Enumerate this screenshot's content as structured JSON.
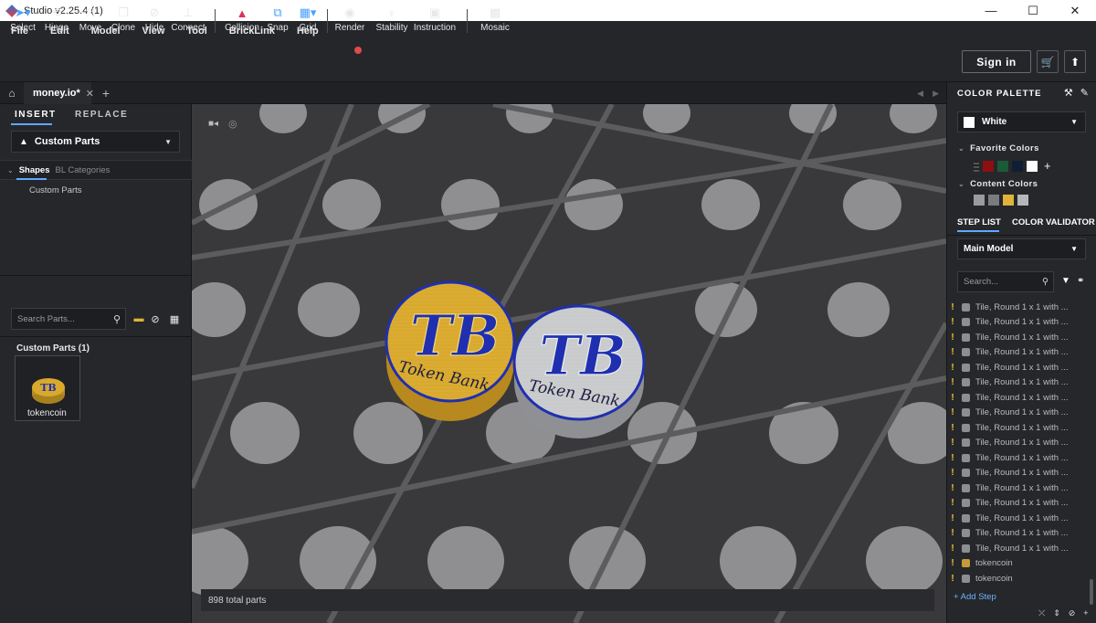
{
  "window": {
    "title": "Studio v2.25.4 (1)",
    "minimize": "—",
    "maximize": "☐",
    "close": "✕"
  },
  "menu": [
    "File",
    "Edit",
    "Model",
    "View",
    "Tool",
    "BrickLink",
    "Help"
  ],
  "toolbar": {
    "tools": [
      {
        "label": "Select",
        "icon": "select-arrow-icon",
        "glyph": "➤▾"
      },
      {
        "label": "Hinge",
        "icon": "hinge-icon",
        "glyph": "⟲"
      },
      {
        "label": "Move",
        "icon": "move-icon",
        "glyph": "⤧"
      },
      {
        "label": "Clone",
        "icon": "clone-icon",
        "glyph": "❐"
      },
      {
        "label": "Hide",
        "icon": "hide-icon",
        "glyph": "⊘"
      },
      {
        "label": "Connect",
        "icon": "connect-icon",
        "glyph": "⊥"
      },
      {
        "label": "Collision",
        "icon": "collision-icon",
        "glyph": "▲"
      },
      {
        "label": "Snap",
        "icon": "snap-icon",
        "glyph": "⧉"
      },
      {
        "label": "Grid",
        "icon": "grid-icon",
        "glyph": "▦▾"
      },
      {
        "label": "Render",
        "icon": "render-camera-icon",
        "glyph": "◉"
      },
      {
        "label": "Stability",
        "icon": "stability-icon",
        "glyph": "♆"
      },
      {
        "label": "Instruction",
        "icon": "instruction-icon",
        "glyph": "▣"
      },
      {
        "label": "Mosaic",
        "icon": "mosaic-icon",
        "glyph": "▩"
      }
    ],
    "sign_in": "Sign in",
    "cart_icon": "🛒",
    "upload_icon": "⬆",
    "collision_color": "#e0305a",
    "snap_color": "#4aa0ff",
    "render_badge_color": "#e04a4a"
  },
  "tabs": {
    "home": "⌂",
    "document": "money.io*",
    "close": "✕",
    "add": "+",
    "nav_prev": "◀",
    "nav_next": "▶"
  },
  "left_panel": {
    "tab_insert": "INSERT",
    "tab_replace": "REPLACE",
    "parts_dropdown": "Custom Parts",
    "shapes_tab": "Shapes",
    "bl_categories_tab": "BL Categories",
    "category_item": "Custom Parts",
    "search_placeholder": "Search Parts...",
    "custom_parts_count": "Custom Parts (1)",
    "part_name": "tokencoin"
  },
  "viewport": {
    "status": "898 total parts",
    "coin_text_top": "TB",
    "coin_text_bottom": "Token Bank",
    "coin_gold_color": "#d8a92c",
    "coin_silver_color": "#c9cacc",
    "coin_ink_color": "#1f2fb0"
  },
  "right_panel": {
    "color_palette_title": "COLOR PALETTE",
    "selected_color": "White",
    "favorite_colors_label": "Favorite Colors",
    "favorite_colors": [
      "#2a2a2a",
      "#8c1010",
      "#1b5a36",
      "#0f1f33",
      "#ffffff"
    ],
    "content_colors_label": "Content Colors",
    "content_colors": [
      "#9a9b9f",
      "#7a7b80",
      "#e0b43a",
      "#b6b7bb"
    ],
    "tab_step_list": "STEP LIST",
    "tab_color_validator": "COLOR VALIDATOR",
    "model_dropdown": "Main Model",
    "search_placeholder": "Search...",
    "steps": [
      {
        "label": "Tile, Round 1 x 1 with ...",
        "warn": true,
        "gold": false
      },
      {
        "label": "Tile, Round 1 x 1 with ...",
        "warn": true,
        "gold": false
      },
      {
        "label": "Tile, Round 1 x 1 with ...",
        "warn": true,
        "gold": false
      },
      {
        "label": "Tile, Round 1 x 1 with ...",
        "warn": true,
        "gold": false
      },
      {
        "label": "Tile, Round 1 x 1 with ...",
        "warn": true,
        "gold": false
      },
      {
        "label": "Tile, Round 1 x 1 with ...",
        "warn": true,
        "gold": false
      },
      {
        "label": "Tile, Round 1 x 1 with ...",
        "warn": true,
        "gold": false
      },
      {
        "label": "Tile, Round 1 x 1 with ...",
        "warn": true,
        "gold": false
      },
      {
        "label": "Tile, Round 1 x 1 with ...",
        "warn": true,
        "gold": false
      },
      {
        "label": "Tile, Round 1 x 1 with ...",
        "warn": true,
        "gold": false
      },
      {
        "label": "Tile, Round 1 x 1 with ...",
        "warn": true,
        "gold": false
      },
      {
        "label": "Tile, Round 1 x 1 with ...",
        "warn": true,
        "gold": false
      },
      {
        "label": "Tile, Round 1 x 1 with ...",
        "warn": true,
        "gold": false
      },
      {
        "label": "Tile, Round 1 x 1 with ...",
        "warn": true,
        "gold": false
      },
      {
        "label": "Tile, Round 1 x 1 with ...",
        "warn": true,
        "gold": false
      },
      {
        "label": "Tile, Round 1 x 1 with ...",
        "warn": true,
        "gold": false
      },
      {
        "label": "Tile, Round 1 x 1 with ...",
        "warn": true,
        "gold": false
      },
      {
        "label": "tokencoin",
        "warn": true,
        "gold": true
      },
      {
        "label": "tokencoin",
        "warn": true,
        "gold": false
      }
    ],
    "add_step": "+ Add Step"
  }
}
